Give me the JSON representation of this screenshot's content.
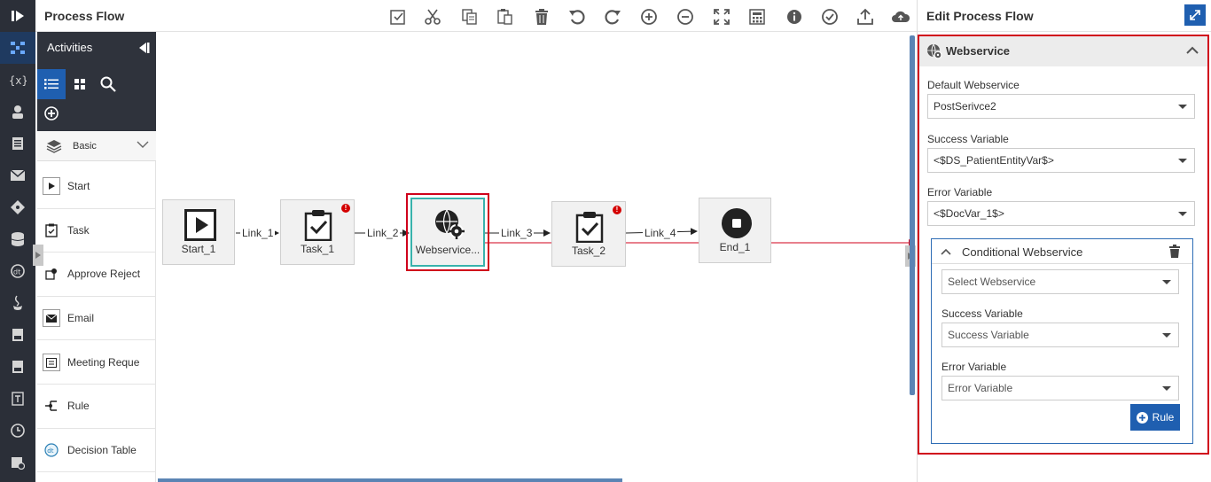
{
  "header": {
    "title": "Process Flow"
  },
  "palette": {
    "title": "Activities",
    "category": "Basic",
    "items": [
      {
        "label": "Start",
        "icon": "play-icon"
      },
      {
        "label": "Task",
        "icon": "clipboard-icon"
      },
      {
        "label": "Approve Reject",
        "icon": "approve-icon"
      },
      {
        "label": "Email",
        "icon": "envelope-icon"
      },
      {
        "label": "Meeting Reque",
        "icon": "calendar-icon"
      },
      {
        "label": "Rule",
        "icon": "rule-icon"
      },
      {
        "label": "Decision Table",
        "icon": "decision-table-icon"
      }
    ]
  },
  "canvas": {
    "nodes": [
      {
        "label": "Start_1"
      },
      {
        "label": "Task_1",
        "error": "!"
      },
      {
        "label": "Webservice..."
      },
      {
        "label": "Task_2",
        "error": "!"
      },
      {
        "label": "End_1"
      }
    ],
    "links": [
      "Link_1",
      "Link_2",
      "Link_3",
      "Link_4"
    ]
  },
  "panel": {
    "title": "Edit Process Flow",
    "section": "Webservice",
    "default_webservice_label": "Default Webservice",
    "default_webservice_value": "PostSerivce2",
    "success_variable_label": "Success Variable",
    "success_variable_value": "<$DS_PatientEntityVar$>",
    "error_variable_label": "Error Variable",
    "error_variable_value": "<$DocVar_1$>",
    "conditional": {
      "title": "Conditional Webservice",
      "webservice_placeholder": "Select Webservice",
      "success_label": "Success Variable",
      "success_placeholder": "Success Variable",
      "error_label": "Error Variable",
      "error_placeholder": "Error Variable",
      "rule_button": "Rule"
    }
  },
  "colors": {
    "accent": "#1f5fb0",
    "highlight": "#d0021b",
    "rail": "#2b2f38"
  }
}
